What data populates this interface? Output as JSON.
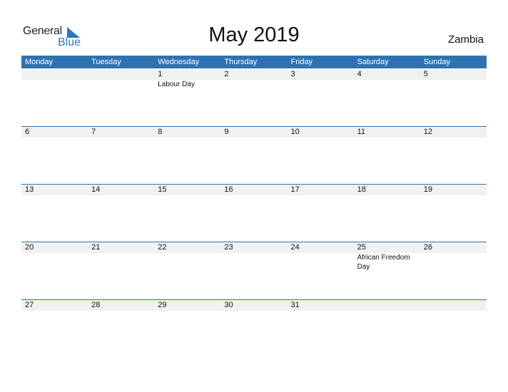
{
  "logo": {
    "word1": "General",
    "word2": "Blue",
    "brand_color": "#2b78c2"
  },
  "title": "May 2019",
  "country": "Zambia",
  "colors": {
    "header_bg": "#2e72b3",
    "day_band": "#f1f1f1"
  },
  "weekdays": [
    "Monday",
    "Tuesday",
    "Wednesday",
    "Thursday",
    "Friday",
    "Saturday",
    "Sunday"
  ],
  "weeks": [
    {
      "days": [
        {
          "num": "",
          "holiday": ""
        },
        {
          "num": "",
          "holiday": ""
        },
        {
          "num": "1",
          "holiday": "Labour Day"
        },
        {
          "num": "2",
          "holiday": ""
        },
        {
          "num": "3",
          "holiday": ""
        },
        {
          "num": "4",
          "holiday": ""
        },
        {
          "num": "5",
          "holiday": ""
        }
      ]
    },
    {
      "days": [
        {
          "num": "6",
          "holiday": ""
        },
        {
          "num": "7",
          "holiday": ""
        },
        {
          "num": "8",
          "holiday": ""
        },
        {
          "num": "9",
          "holiday": ""
        },
        {
          "num": "10",
          "holiday": ""
        },
        {
          "num": "11",
          "holiday": ""
        },
        {
          "num": "12",
          "holiday": ""
        }
      ]
    },
    {
      "days": [
        {
          "num": "13",
          "holiday": ""
        },
        {
          "num": "14",
          "holiday": ""
        },
        {
          "num": "15",
          "holiday": ""
        },
        {
          "num": "16",
          "holiday": ""
        },
        {
          "num": "17",
          "holiday": ""
        },
        {
          "num": "18",
          "holiday": ""
        },
        {
          "num": "19",
          "holiday": ""
        }
      ]
    },
    {
      "days": [
        {
          "num": "20",
          "holiday": ""
        },
        {
          "num": "21",
          "holiday": ""
        },
        {
          "num": "22",
          "holiday": ""
        },
        {
          "num": "23",
          "holiday": ""
        },
        {
          "num": "24",
          "holiday": ""
        },
        {
          "num": "25",
          "holiday": "African Freedom Day"
        },
        {
          "num": "26",
          "holiday": ""
        }
      ]
    },
    {
      "days": [
        {
          "num": "27",
          "holiday": ""
        },
        {
          "num": "28",
          "holiday": ""
        },
        {
          "num": "29",
          "holiday": ""
        },
        {
          "num": "30",
          "holiday": ""
        },
        {
          "num": "31",
          "holiday": ""
        },
        {
          "num": "",
          "holiday": ""
        },
        {
          "num": "",
          "holiday": ""
        }
      ]
    }
  ]
}
